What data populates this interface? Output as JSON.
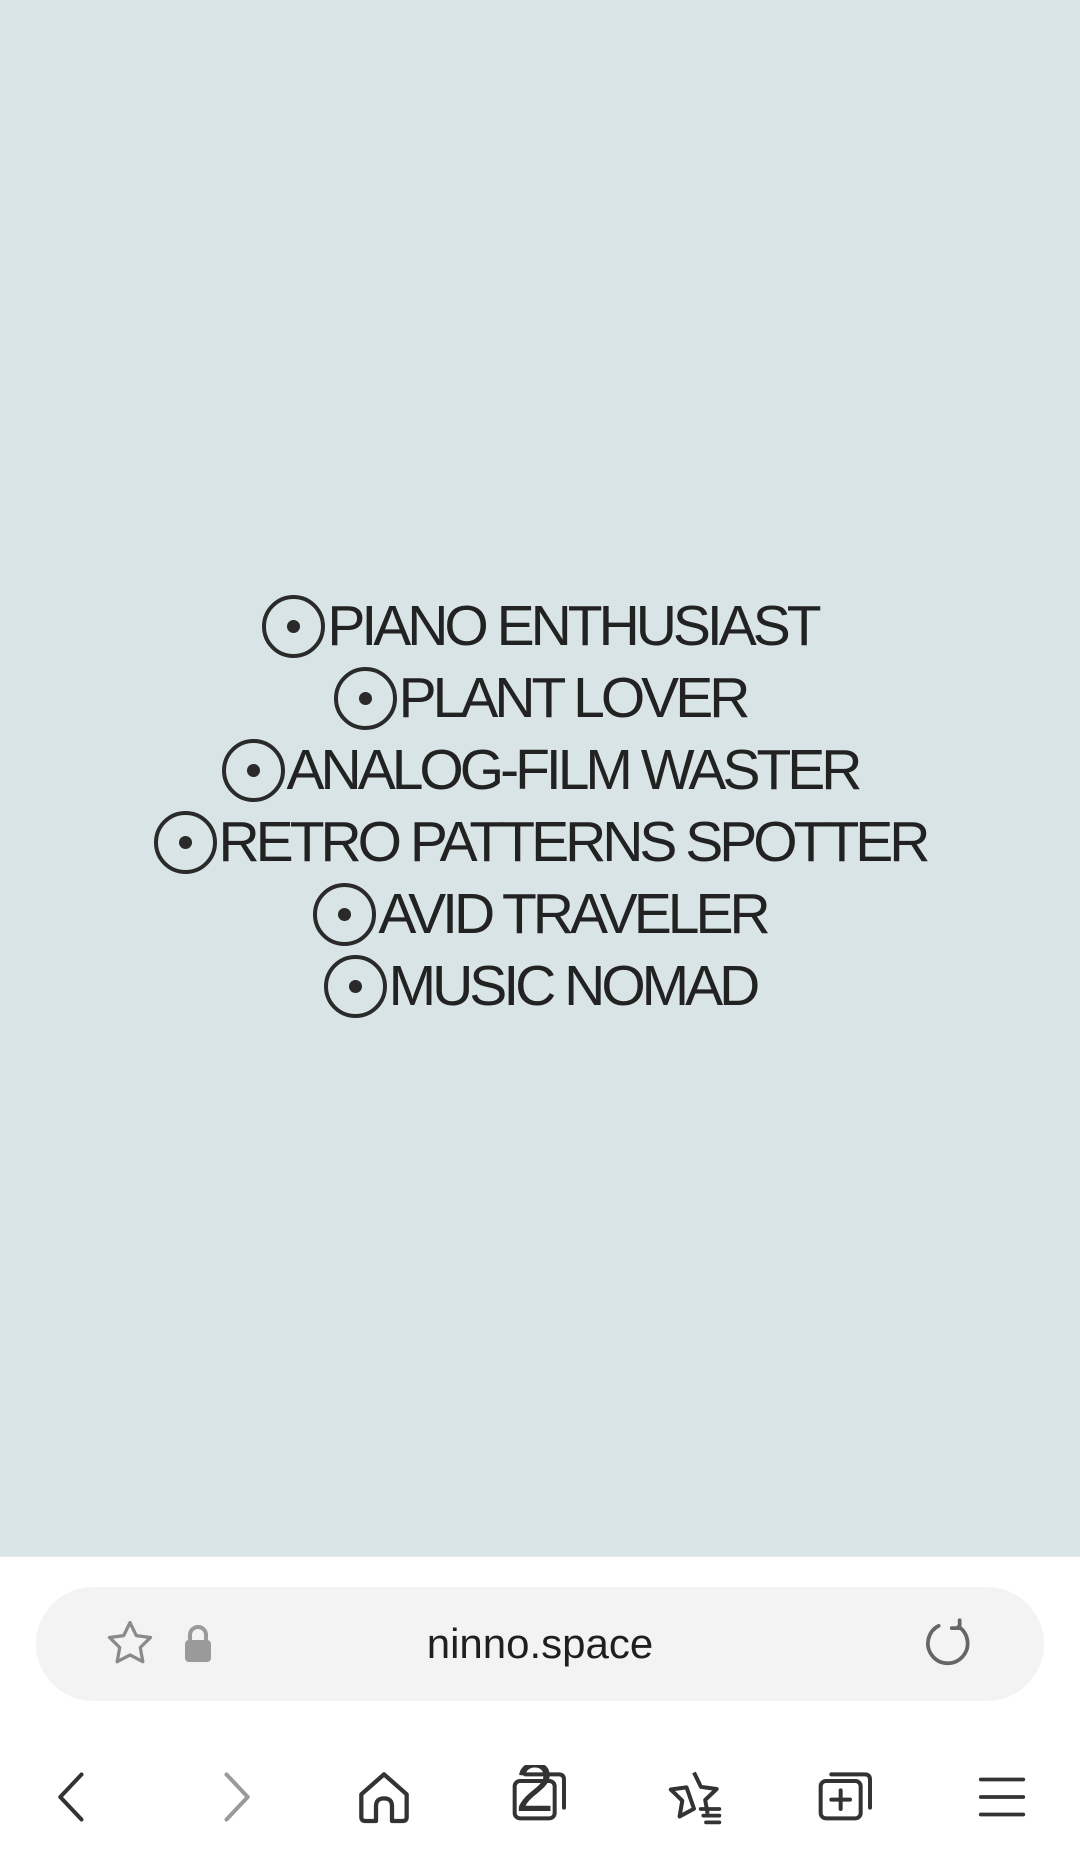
{
  "page": {
    "background_color": "#d9e4e6",
    "text_color": "#222222",
    "interests": [
      {
        "label": "PIANO ENTHUSIAST",
        "icon": "target-dot-icon"
      },
      {
        "label": "PLANT LOVER",
        "icon": "target-dot-icon"
      },
      {
        "label": "ANALOG-FILM WASTER",
        "icon": "target-dot-icon"
      },
      {
        "label": "RETRO PATTERNS SPOTTER",
        "icon": "target-dot-icon"
      },
      {
        "label": "AVID TRAVELER",
        "icon": "target-dot-icon"
      },
      {
        "label": "MUSIC NOMAD",
        "icon": "target-dot-icon"
      }
    ]
  },
  "browser": {
    "url": "ninno.space",
    "url_bar_icons": [
      "star-outline-icon",
      "lock-icon",
      "reload-icon"
    ],
    "tab_count": "2",
    "nav_icons": [
      "back-icon",
      "forward-icon",
      "home-icon",
      "tabs-icon",
      "bookmarks-icon",
      "new-tab-icon",
      "menu-icon"
    ]
  }
}
